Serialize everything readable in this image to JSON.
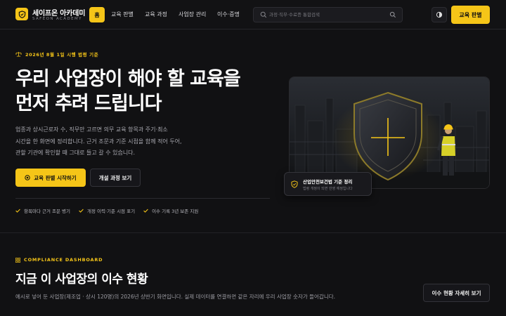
{
  "header": {
    "brand_name": "세이프온 아카데미",
    "brand_sub": "SAFEON ACADEMY",
    "home_label": "홈",
    "nav": [
      "교육 판별",
      "교육 과정",
      "사업장 관리",
      "이수·증명"
    ],
    "search_placeholder": "과정·직무·수료증 통합검색",
    "cta_label": "교육 판별"
  },
  "hero": {
    "eyebrow": "2026년 8월 1일 시행 법령 기준",
    "headline_line1": "우리 사업장이 해야 할 교육을",
    "headline_line2": "먼저 추려 드립니다",
    "desc_line1": "업종과 상시근로자 수, 직무만 고르면 의무 교육 항목과 주기·최소",
    "desc_line2": "시간을 한 화면에 정리합니다. 근거 조문과 기준 시점을 함께 적어 두어,",
    "desc_line3": "관할 기관에 확인할 때 그대로 들고 갈 수 있습니다.",
    "primary_button": "교육 판별 시작하기",
    "secondary_button": "개설 과정 보기",
    "checks": [
      "항목마다 근거 조문 병기",
      "개정 이력·기준 시점 표기",
      "이수 기록 3년 보존 지원"
    ],
    "badge_title": "산업안전보건법 기준 정리",
    "badge_sub": "법령 개정이 되면 반영 예정입니다"
  },
  "dashboard": {
    "eyebrow": "COMPLIANCE DASHBOARD",
    "title": "지금 이 사업장의 이수 현황",
    "desc": "예시로 넣어 둔 사업장(제조업 · 상시 120명)의 2026년 상반기 화면입니다. 실제 데이터를 연결하면 같은 자리에 우리 사업장 숫자가 들어갑니다.",
    "detail_button": "이수 현황 자세히 보기"
  },
  "colors": {
    "accent": "#f5c518",
    "background": "#111113"
  },
  "icons": [
    "shield-logo-icon",
    "search-icon",
    "search-submit-icon",
    "theme-toggle-icon",
    "law-scale-icon",
    "check-icon",
    "shield-check-icon",
    "grid-icon"
  ]
}
